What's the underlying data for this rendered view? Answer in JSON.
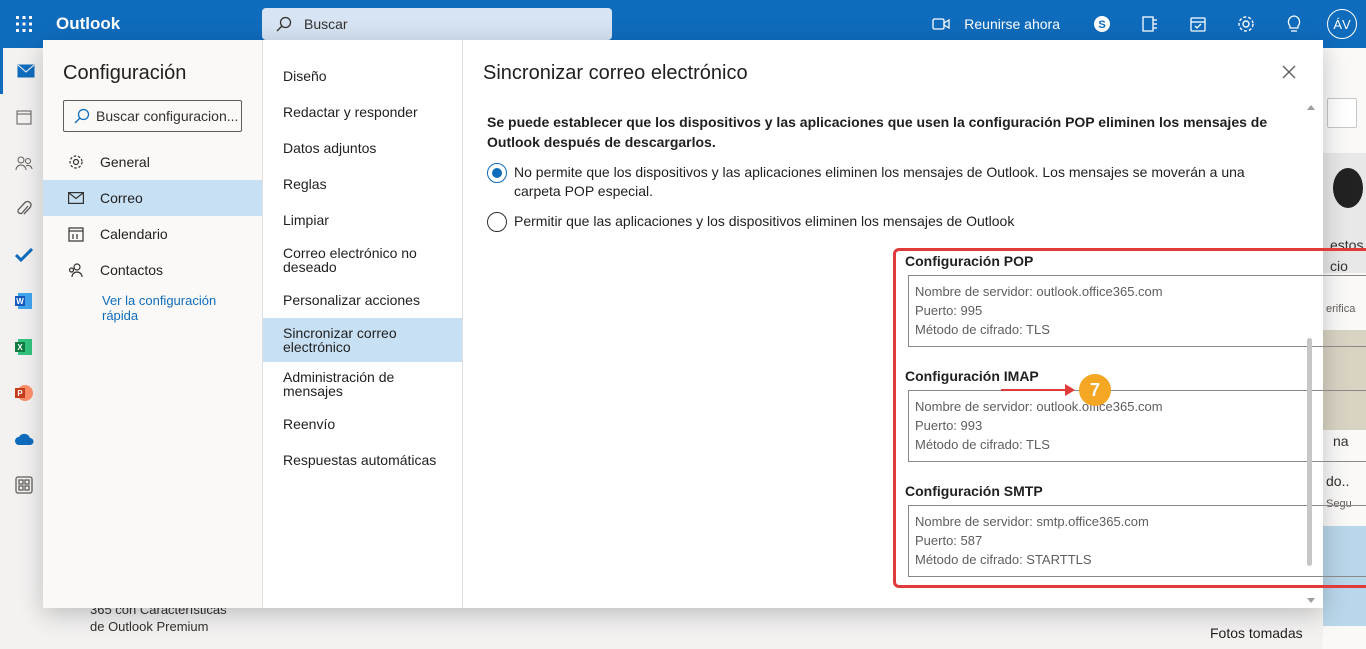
{
  "topbar": {
    "app_name": "Outlook",
    "search_placeholder": "Buscar",
    "meet_now": "Reunirse ahora",
    "avatar_initials": "ÁV"
  },
  "background": {
    "bottom_text_line1": "365 con Características",
    "bottom_text_line2": "de Outlook Premium",
    "right_peek_1": "estos",
    "right_peek_2": "cio",
    "right_peek_3": "erifica",
    "right_peek_4": "na",
    "right_peek_5": "do..",
    "right_peek_6": "Segu",
    "photos_label": "Fotos tomadas"
  },
  "settings": {
    "title": "Configuración",
    "search_placeholder": "Buscar configuracion...",
    "categories": [
      {
        "label": "General",
        "icon": "gear-icon"
      },
      {
        "label": "Correo",
        "icon": "mail-icon"
      },
      {
        "label": "Calendario",
        "icon": "calendar-icon"
      },
      {
        "label": "Contactos",
        "icon": "people-icon"
      }
    ],
    "quick_settings": "Ver la configuración rápida",
    "mail_sections": [
      "Diseño",
      "Redactar y responder",
      "Datos adjuntos",
      "Reglas",
      "Limpiar",
      "Correo electrónico no deseado",
      "Personalizar acciones",
      "Sincronizar correo electrónico",
      "Administración de mensajes",
      "Reenvío",
      "Respuestas automáticas"
    ]
  },
  "sync": {
    "title": "Sincronizar correo electrónico",
    "pop_delete_desc": "Se puede establecer que los dispositivos y las aplicaciones que usen la configuración POP eliminen los mensajes de Outlook después de descargarlos.",
    "option_no_delete": "No permite que los dispositivos y las aplicaciones eliminen los mensajes de Outlook. Los mensajes se moverán a una carpeta POP especial.",
    "option_allow_delete": "Permitir que las aplicaciones y los dispositivos eliminen los mensajes de Outlook",
    "pop": {
      "title": "Configuración POP",
      "server": "Nombre de servidor: outlook.office365.com",
      "port": "Puerto: 995",
      "encryption": "Método de cifrado: TLS"
    },
    "imap": {
      "title": "Configuración IMAP",
      "server": "Nombre de servidor: outlook.office365.com",
      "port": "Puerto: 993",
      "encryption": "Método de cifrado: TLS"
    },
    "smtp": {
      "title": "Configuración SMTP",
      "server": "Nombre de servidor: smtp.office365.com",
      "port": "Puerto: 587",
      "encryption": "Método de cifrado: STARTTLS"
    }
  },
  "annotation": {
    "step_number": "7",
    "color": "#e03a3a",
    "badge_color": "#f5a623"
  },
  "colors": {
    "brand": "#0f6cbd",
    "selected": "#c7e0f4"
  }
}
